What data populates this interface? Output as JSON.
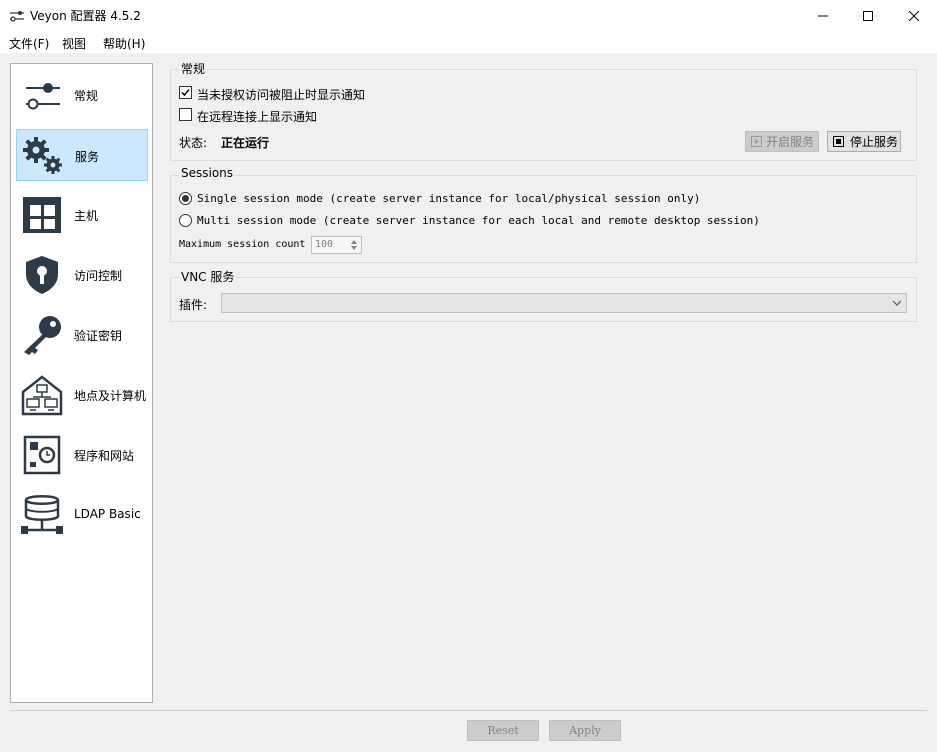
{
  "window": {
    "title": "Veyon 配置器 4.5.2"
  },
  "menu": {
    "items": [
      "文件(F)",
      "视图",
      "帮助(H)"
    ]
  },
  "sidebar": {
    "items": [
      {
        "label": "常规",
        "icon": "sliders-icon"
      },
      {
        "label": "服务",
        "icon": "gears-icon",
        "active": true
      },
      {
        "label": "主机",
        "icon": "windows-grid-icon"
      },
      {
        "label": "访问控制",
        "icon": "shield-lock-icon"
      },
      {
        "label": "验证密钥",
        "icon": "key-icon"
      },
      {
        "label": "地点及计算机",
        "icon": "house-network-icon"
      },
      {
        "label": "程序和网站",
        "icon": "program-clock-icon"
      },
      {
        "label": "LDAP Basic",
        "icon": "database-network-icon"
      }
    ]
  },
  "general": {
    "title": "常规",
    "notify_denied_label": "当未授权访问被阻止时显示通知",
    "notify_denied_checked": true,
    "notify_remote_label": "在远程连接上显示通知",
    "notify_remote_checked": false,
    "status_label": "状态:",
    "status_value": "正在运行",
    "start_button": "开启服务",
    "stop_button": "停止服务"
  },
  "sessions": {
    "title": "Sessions",
    "single_label": "Single session mode (create server instance for local/physical session only)",
    "multi_label": "Multi session mode (create server instance for each local and remote desktop session)",
    "selected": "single",
    "max_count_label": "Maximum session count",
    "max_count_value": "100"
  },
  "vnc": {
    "title": "VNC 服务",
    "plugin_label": "插件:",
    "plugin_value": ""
  },
  "footer": {
    "reset": "Reset",
    "apply": "Apply"
  },
  "colors": {
    "accent": "#cce8ff",
    "icon": "#2d3a47"
  }
}
